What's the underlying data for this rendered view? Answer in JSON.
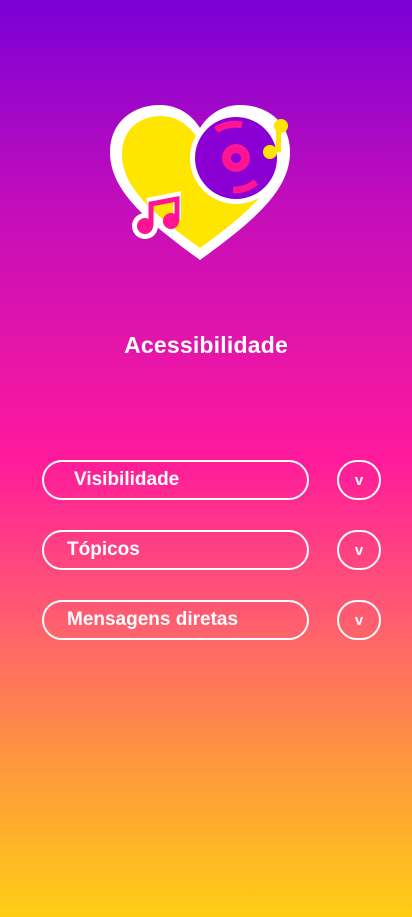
{
  "page": {
    "title": "Acessibilidade"
  },
  "logo": {
    "icon": "heart-music-icon",
    "colors": {
      "heart_fill": "#ffe600",
      "outline": "#ffffff",
      "record": "#8a00d4",
      "note_pink": "#ff1493",
      "note_yellow": "#ffe600"
    }
  },
  "settings": [
    {
      "label": "Visibilidade",
      "toggle": "v"
    },
    {
      "label": "Tópicos",
      "toggle": "v"
    },
    {
      "label": "Mensagens diretas",
      "toggle": "v"
    }
  ],
  "colors": {
    "gradient_top": "#7a00d6",
    "gradient_mid": "#ff1a9c",
    "gradient_bottom": "#ffce14",
    "text": "#ffffff"
  }
}
